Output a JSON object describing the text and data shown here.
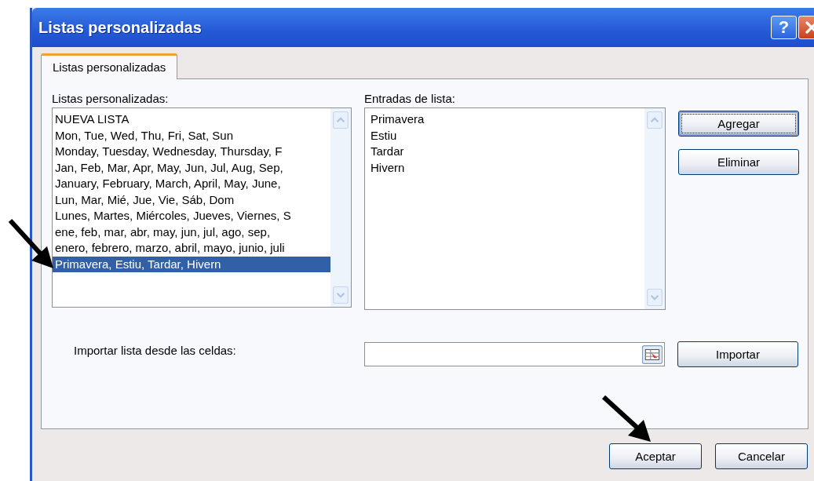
{
  "window": {
    "title": "Listas personalizadas"
  },
  "title_buttons": [
    {
      "kind": "help",
      "label": "?"
    },
    {
      "kind": "close"
    }
  ],
  "tabs": [
    {
      "label": "Listas personalizadas",
      "selected": true
    }
  ],
  "custom_lists": {
    "label": "Listas personalizadas:",
    "items": [
      {
        "text": "NUEVA LISTA",
        "selected": false
      },
      {
        "text": "Mon, Tue, Wed, Thu, Fri, Sat, Sun",
        "selected": false
      },
      {
        "text": "Monday, Tuesday, Wednesday, Thursday, F",
        "selected": false
      },
      {
        "text": "Jan, Feb, Mar, Apr, May, Jun, Jul, Aug, Sep,",
        "selected": false
      },
      {
        "text": "January, February, March, April, May, June,",
        "selected": false
      },
      {
        "text": "Lun, Mar, Mié, Jue, Vie, Sáb, Dom",
        "selected": false
      },
      {
        "text": "Lunes, Martes, Miércoles, Jueves, Viernes, S",
        "selected": false
      },
      {
        "text": "ene, feb, mar, abr, may, jun, jul, ago, sep,",
        "selected": false
      },
      {
        "text": "enero, febrero, marzo, abril, mayo, junio, juli",
        "selected": false
      },
      {
        "text": "Primavera, Estiu, Tardar, Hivern",
        "selected": true
      }
    ]
  },
  "list_entries": {
    "label": "Entradas de lista:",
    "items": [
      "Primavera",
      "Estiu",
      "Tardar",
      "Hivern"
    ]
  },
  "side_buttons": [
    {
      "label": "Agregar",
      "default": true
    },
    {
      "label": "Eliminar",
      "default": false
    }
  ],
  "import": {
    "label": "Importar lista desde las celdas:",
    "button": {
      "label": "Importar"
    }
  },
  "footer_buttons": [
    {
      "label": "Aceptar"
    },
    {
      "label": "Cancelar"
    }
  ]
}
